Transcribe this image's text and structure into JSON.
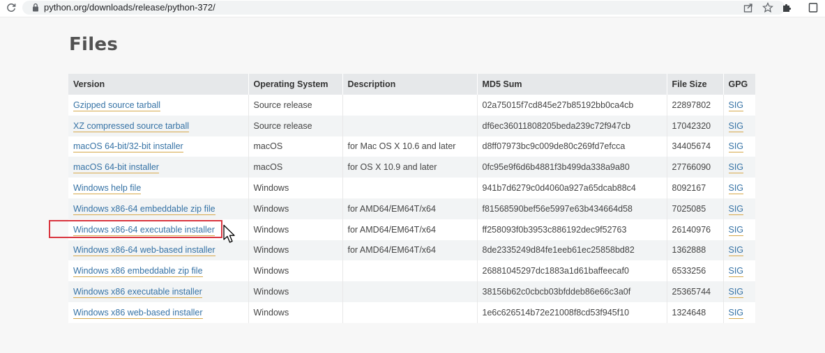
{
  "browser": {
    "url": "python.org/downloads/release/python-372/",
    "icons": [
      "reload-icon",
      "lock-icon",
      "share-icon",
      "star-icon",
      "extensions-icon",
      "window-icon"
    ]
  },
  "page": {
    "title": "Files"
  },
  "table": {
    "headers": [
      "Version",
      "Operating System",
      "Description",
      "MD5 Sum",
      "File Size",
      "GPG"
    ],
    "rows": [
      {
        "version": "Gzipped source tarball",
        "os": "Source release",
        "description": "",
        "md5": "02a75015f7cd845e27b85192bb0ca4cb",
        "size": "22897802",
        "gpg": "SIG"
      },
      {
        "version": "XZ compressed source tarball",
        "os": "Source release",
        "description": "",
        "md5": "df6ec36011808205beda239c72f947cb",
        "size": "17042320",
        "gpg": "SIG"
      },
      {
        "version": "macOS 64-bit/32-bit installer",
        "os": "macOS",
        "description": "for Mac OS X 10.6 and later",
        "md5": "d8ff07973bc9c009de80c269fd7efcca",
        "size": "34405674",
        "gpg": "SIG"
      },
      {
        "version": "macOS 64-bit installer",
        "os": "macOS",
        "description": "for OS X 10.9 and later",
        "md5": "0fc95e9f6d6b4881f3b499da338a9a80",
        "size": "27766090",
        "gpg": "SIG"
      },
      {
        "version": "Windows help file",
        "os": "Windows",
        "description": "",
        "md5": "941b7d6279c0d4060a927a65dcab88c4",
        "size": "8092167",
        "gpg": "SIG"
      },
      {
        "version": "Windows x86-64 embeddable zip file",
        "os": "Windows",
        "description": "for AMD64/EM64T/x64",
        "md5": "f81568590bef56e5997e63b434664d58",
        "size": "7025085",
        "gpg": "SIG"
      },
      {
        "version": "Windows x86-64 executable installer",
        "os": "Windows",
        "description": "for AMD64/EM64T/x64",
        "md5": "ff258093f0b3953c886192dec9f52763",
        "size": "26140976",
        "gpg": "SIG"
      },
      {
        "version": "Windows x86-64 web-based installer",
        "os": "Windows",
        "description": "for AMD64/EM64T/x64",
        "md5": "8de2335249d84fe1eeb61ec25858bd82",
        "size": "1362888",
        "gpg": "SIG"
      },
      {
        "version": "Windows x86 embeddable zip file",
        "os": "Windows",
        "description": "",
        "md5": "26881045297dc1883a1d61baffeecaf0",
        "size": "6533256",
        "gpg": "SIG"
      },
      {
        "version": "Windows x86 executable installer",
        "os": "Windows",
        "description": "",
        "md5": "38156b62c0cbcb03bfddeb86e66c3a0f",
        "size": "25365744",
        "gpg": "SIG"
      },
      {
        "version": "Windows x86 web-based installer",
        "os": "Windows",
        "description": "",
        "md5": "1e6c626514b72e21008f8cd53f945f10",
        "size": "1324648",
        "gpg": "SIG"
      }
    ]
  },
  "colors": {
    "link": "#3572a5",
    "link_underline": "#d6a84a",
    "highlight_border": "#d9343e",
    "header_bg": "#e6e8ea"
  }
}
